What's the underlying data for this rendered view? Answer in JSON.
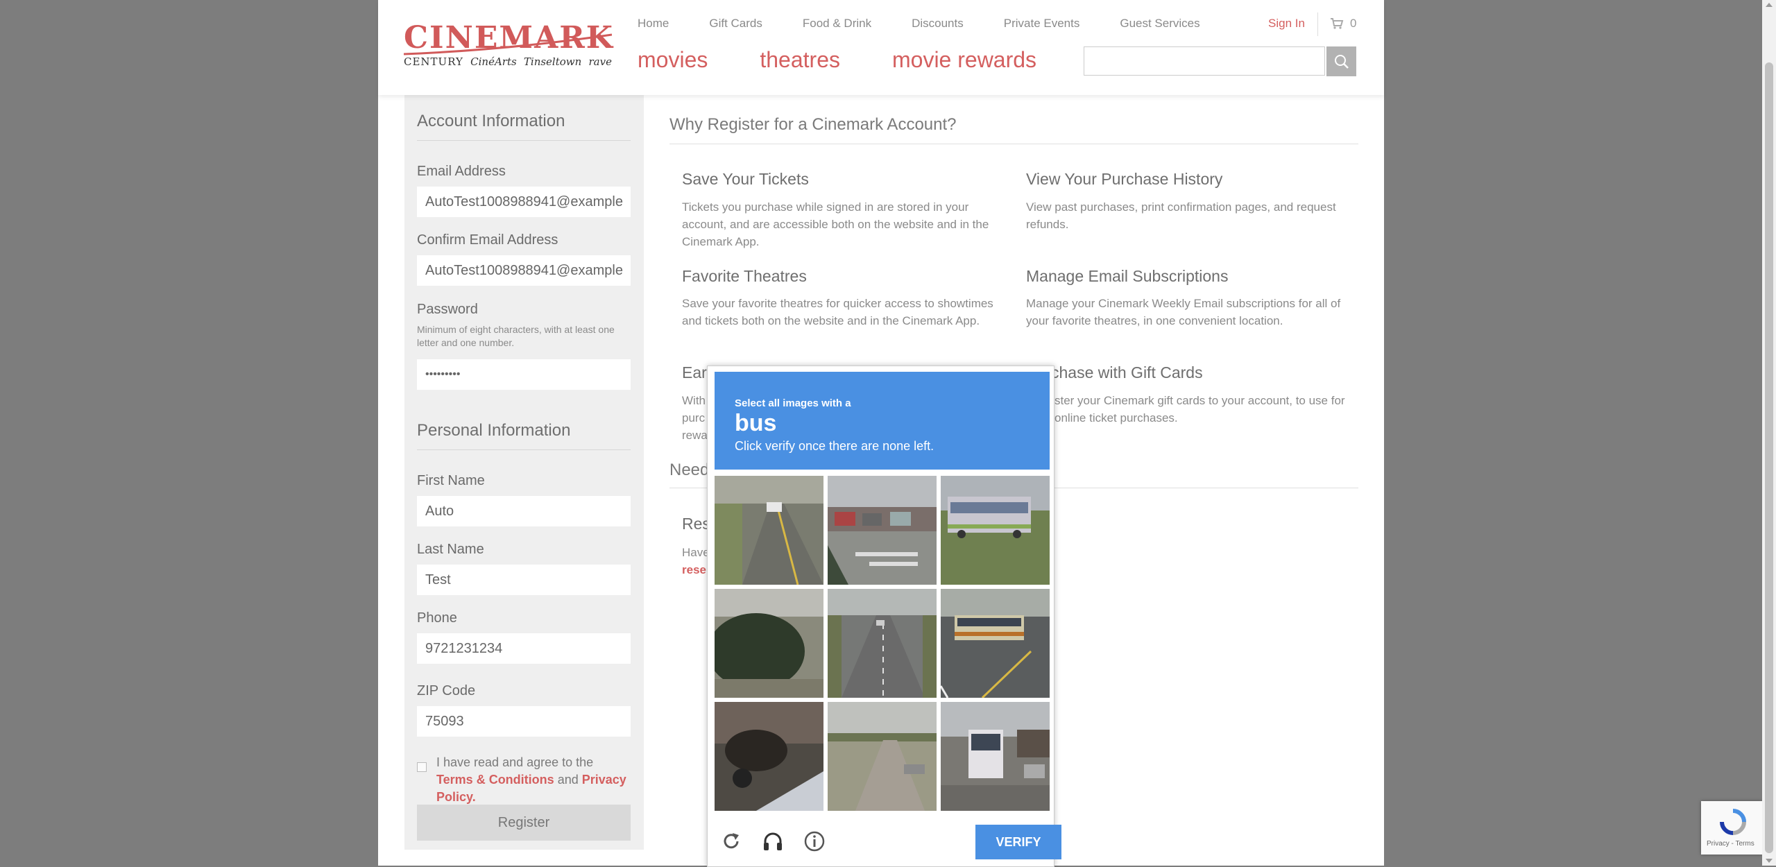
{
  "header": {
    "logo": {
      "main": "CINEMARK",
      "sub": [
        "CENTURY",
        "CinéArts",
        "Tinseltown",
        "rave"
      ]
    },
    "top_nav": [
      "Home",
      "Gift Cards",
      "Food & Drink",
      "Discounts",
      "Private Events",
      "Guest Services"
    ],
    "main_nav": [
      "movies",
      "theatres",
      "movie rewards"
    ],
    "sign_in": "Sign In",
    "cart_count": "0",
    "search_placeholder": ""
  },
  "account": {
    "section_title": "Account Information",
    "email_label": "Email Address",
    "email_value": "AutoTest1008988941@example",
    "confirm_email_label": "Confirm Email Address",
    "confirm_email_value": "AutoTest1008988941@example",
    "password_label": "Password",
    "password_note": "Minimum of eight characters, with at least one letter and one number.",
    "password_value": "•••••••••"
  },
  "personal": {
    "section_title": "Personal Information",
    "first_name_label": "First Name",
    "first_name_value": "Auto",
    "last_name_label": "Last Name",
    "last_name_value": "Test",
    "phone_label": "Phone",
    "phone_value": "9721231234",
    "zip_label": "ZIP Code",
    "zip_value": "75093"
  },
  "agree": {
    "prefix": "I have read and agree to the",
    "terms": "Terms & Conditions",
    "and": "and",
    "privacy": "Privacy Policy."
  },
  "register_button": "Register",
  "why": {
    "title": "Why Register for a Cinemark Account?",
    "benefits": [
      {
        "heading": "Save Your Tickets",
        "text": "Tickets you purchase while signed in are stored in your account, and are accessible both on the website and in the Cinemark App."
      },
      {
        "heading": "View Your Purchase History",
        "text": "View past purchases, print confirmation pages, and request refunds."
      },
      {
        "heading": "Favorite Theatres",
        "text": "Save your favorite theatres for quicker access to showtimes and tickets both on the website and in the Cinemark App."
      },
      {
        "heading": "Manage Email Subscriptions",
        "text": "Manage your Cinemark Weekly Email subscriptions for all of your favorite theatres, in one convenient location."
      },
      {
        "heading": "Earn",
        "text": "With purc rewa"
      },
      {
        "heading": "chase with Gift Cards",
        "text": "ster your Cinemark gift cards to your account, to use for online ticket purchases."
      }
    ]
  },
  "need": {
    "title": "Need",
    "res_heading": "Res",
    "res_text": "Have",
    "res_link": "rese"
  },
  "captcha": {
    "instruction_small": "Select all images with a",
    "target": "bus",
    "instruction": "Click verify once there are none left.",
    "verify_button": "VERIFY",
    "tiles": [
      "road-with-cars",
      "parking-lot",
      "bus-on-grass",
      "tree",
      "highway",
      "bus-on-street",
      "motorcycle",
      "road-rural",
      "bus-at-stop"
    ]
  },
  "recaptcha_badge": "Privacy - Terms"
}
